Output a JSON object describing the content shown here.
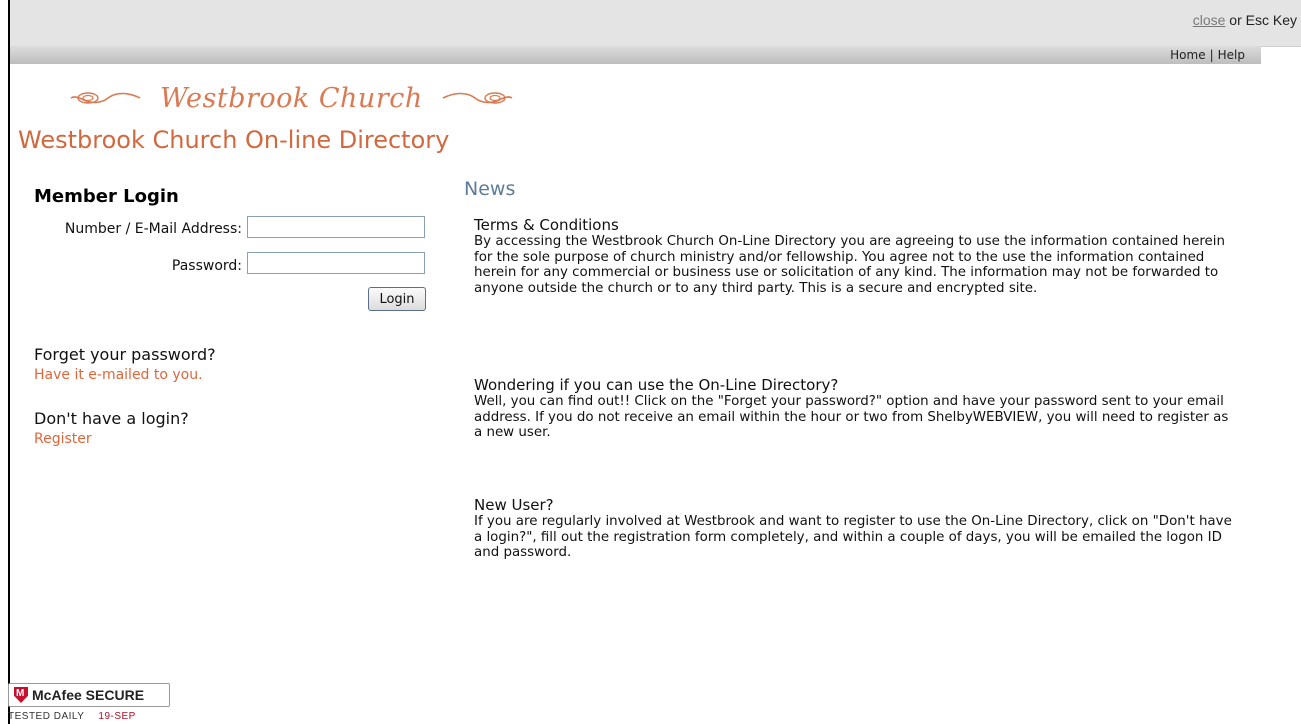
{
  "topbar": {
    "close_label": "close",
    "close_suffix": " or Esc Key"
  },
  "nav": {
    "home": "Home",
    "separator": "|",
    "help": "Help"
  },
  "logo": {
    "text": "Westbrook Church"
  },
  "site_title": "Westbrook Church On-line Directory",
  "login": {
    "heading": "Member Login",
    "email_label": "Number / E-Mail Address:",
    "email_value": "",
    "password_label": "Password:",
    "password_value": "",
    "button_label": "Login"
  },
  "forgot": {
    "question": "Forget your password?",
    "link": "Have it e-mailed to you."
  },
  "register": {
    "question": "Don't have a login?",
    "link": "Register"
  },
  "news": {
    "heading": "News",
    "items": [
      {
        "title": "Terms & Conditions",
        "body": "By accessing the Westbrook Church On-Line Directory you are agreeing to use the information contained herein for the sole purpose of church ministry and/or fellowship. You agree not to the use the information contained herein for any commercial or business use or solicitation of any kind. The information may not be forwarded to anyone outside the church or to any third party. This is a secure and encrypted site."
      },
      {
        "title": "Wondering if you can use the On-Line Directory?",
        "body": "Well, you can find out!! Click on the \"Forget your password?\" option and have your password sent to your email address. If you do not receive an email within the hour or two from ShelbyWEBVIEW, you will need to register as a new user."
      },
      {
        "title": "New User?",
        "body": "If you are regularly involved at Westbrook and want to register to use the On-Line Directory, click on \"Don't have a login?\", fill out the registration form completely, and within a couple of days, you will be emailed the logon ID and password."
      }
    ]
  },
  "badge": {
    "brand": "McAfee SECURE",
    "tested": "TESTED DAILY",
    "date": "19-SEP"
  },
  "colors": {
    "accent_orange": "#d2693e",
    "link_orange": "#e0663a",
    "news_blue": "#5c7c9a",
    "mcafee_red": "#c8102e"
  }
}
